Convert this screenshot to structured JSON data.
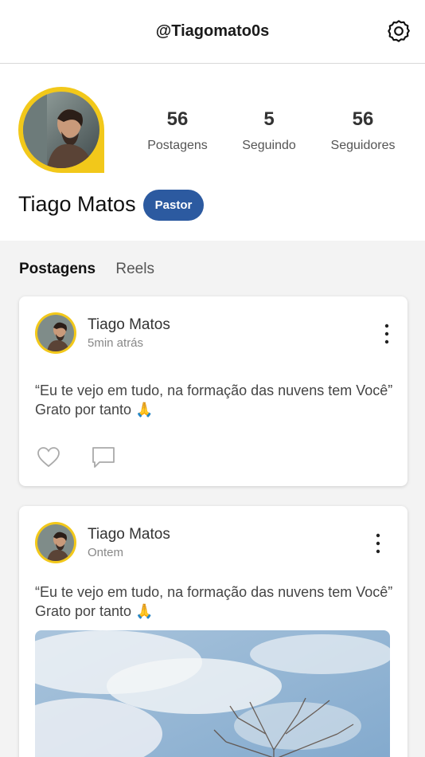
{
  "header": {
    "handle": "@Tiagomato0s",
    "settings_icon": "gear-icon"
  },
  "profile": {
    "name": "Tiago Matos",
    "role_badge": "Pastor",
    "stats": [
      {
        "value": "56",
        "label": "Postagens"
      },
      {
        "value": "5",
        "label": "Seguindo"
      },
      {
        "value": "56",
        "label": "Seguidores"
      }
    ],
    "accent_color": "#f2c81a",
    "badge_color": "#2c5aa0"
  },
  "tabs": [
    {
      "label": "Postagens",
      "active": true
    },
    {
      "label": "Reels",
      "active": false
    }
  ],
  "posts": [
    {
      "author": "Tiago Matos",
      "time": "5min atrás",
      "text": "“Eu te vejo em tudo, na formação das nuvens tem Você” Grato por tanto 🙏",
      "has_photo": false
    },
    {
      "author": "Tiago Matos",
      "time": "Ontem",
      "text": "“Eu te vejo em tudo, na formação das nuvens tem Você” Grato por tanto 🙏",
      "has_photo": true
    }
  ]
}
